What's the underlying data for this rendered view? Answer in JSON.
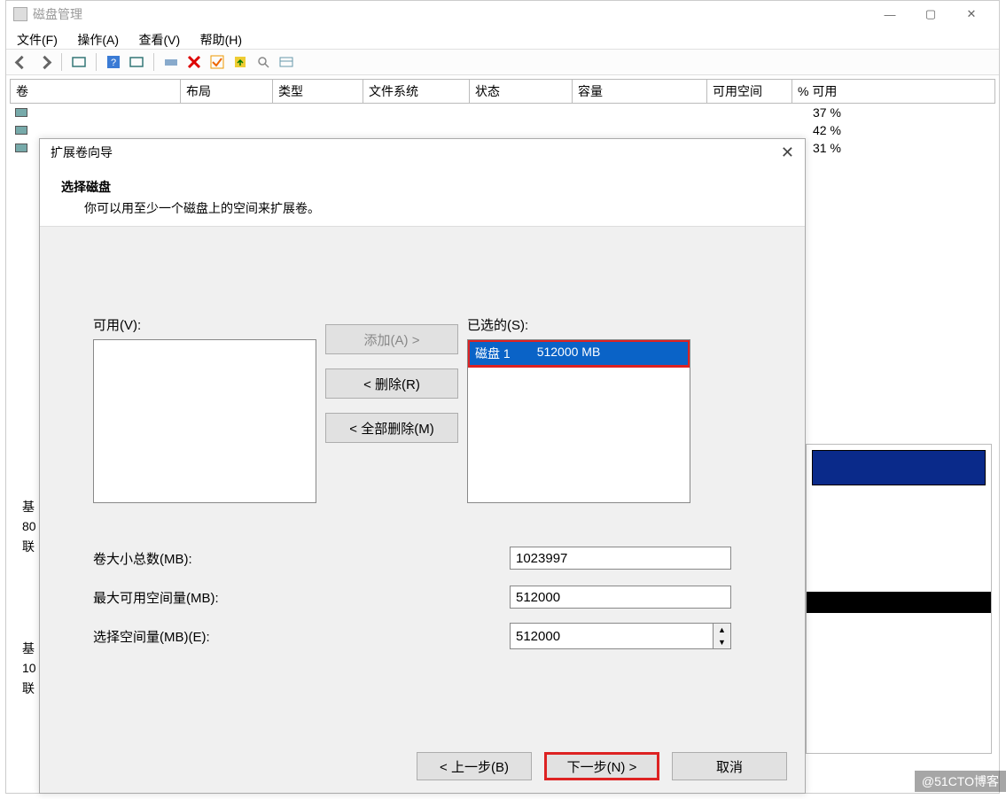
{
  "window": {
    "title": "磁盘管理",
    "winbtns": {
      "min": "—",
      "max": "▢",
      "close": "✕"
    }
  },
  "menubar": [
    "文件(F)",
    "操作(A)",
    "查看(V)",
    "帮助(H)"
  ],
  "columns": {
    "c0": "卷",
    "c1": "布局",
    "c2": "类型",
    "c3": "文件系统",
    "c4": "状态",
    "c5": "容量",
    "c6": "可用空间",
    "c7": "% 可用"
  },
  "pct_rows": [
    "37 %",
    "42 %",
    "31 %"
  ],
  "bg_left": {
    "l1": "基",
    "l2": "80",
    "l3": "联",
    "l4": "基",
    "l5": "10",
    "l6": "联"
  },
  "dialog": {
    "title": "扩展卷向导",
    "close": "✕",
    "heading": "选择磁盘",
    "subheading": "你可以用至少一个磁盘上的空间来扩展卷。",
    "available_label": "可用(V):",
    "selected_label": "已选的(S):",
    "selected_item_disk": "磁盘 1",
    "selected_item_size": "512000 MB",
    "btn_add": "添加(A) >",
    "btn_remove": "< 删除(R)",
    "btn_remove_all": "< 全部删除(M)",
    "total_label": "卷大小总数(MB):",
    "total_value": "1023997",
    "max_label": "最大可用空间量(MB):",
    "max_value": "512000",
    "amount_label": "选择空间量(MB)(E):",
    "amount_value": "512000",
    "btn_back": "< 上一步(B)",
    "btn_next": "下一步(N) >",
    "btn_cancel": "取消"
  },
  "watermark": "@51CTO博客"
}
